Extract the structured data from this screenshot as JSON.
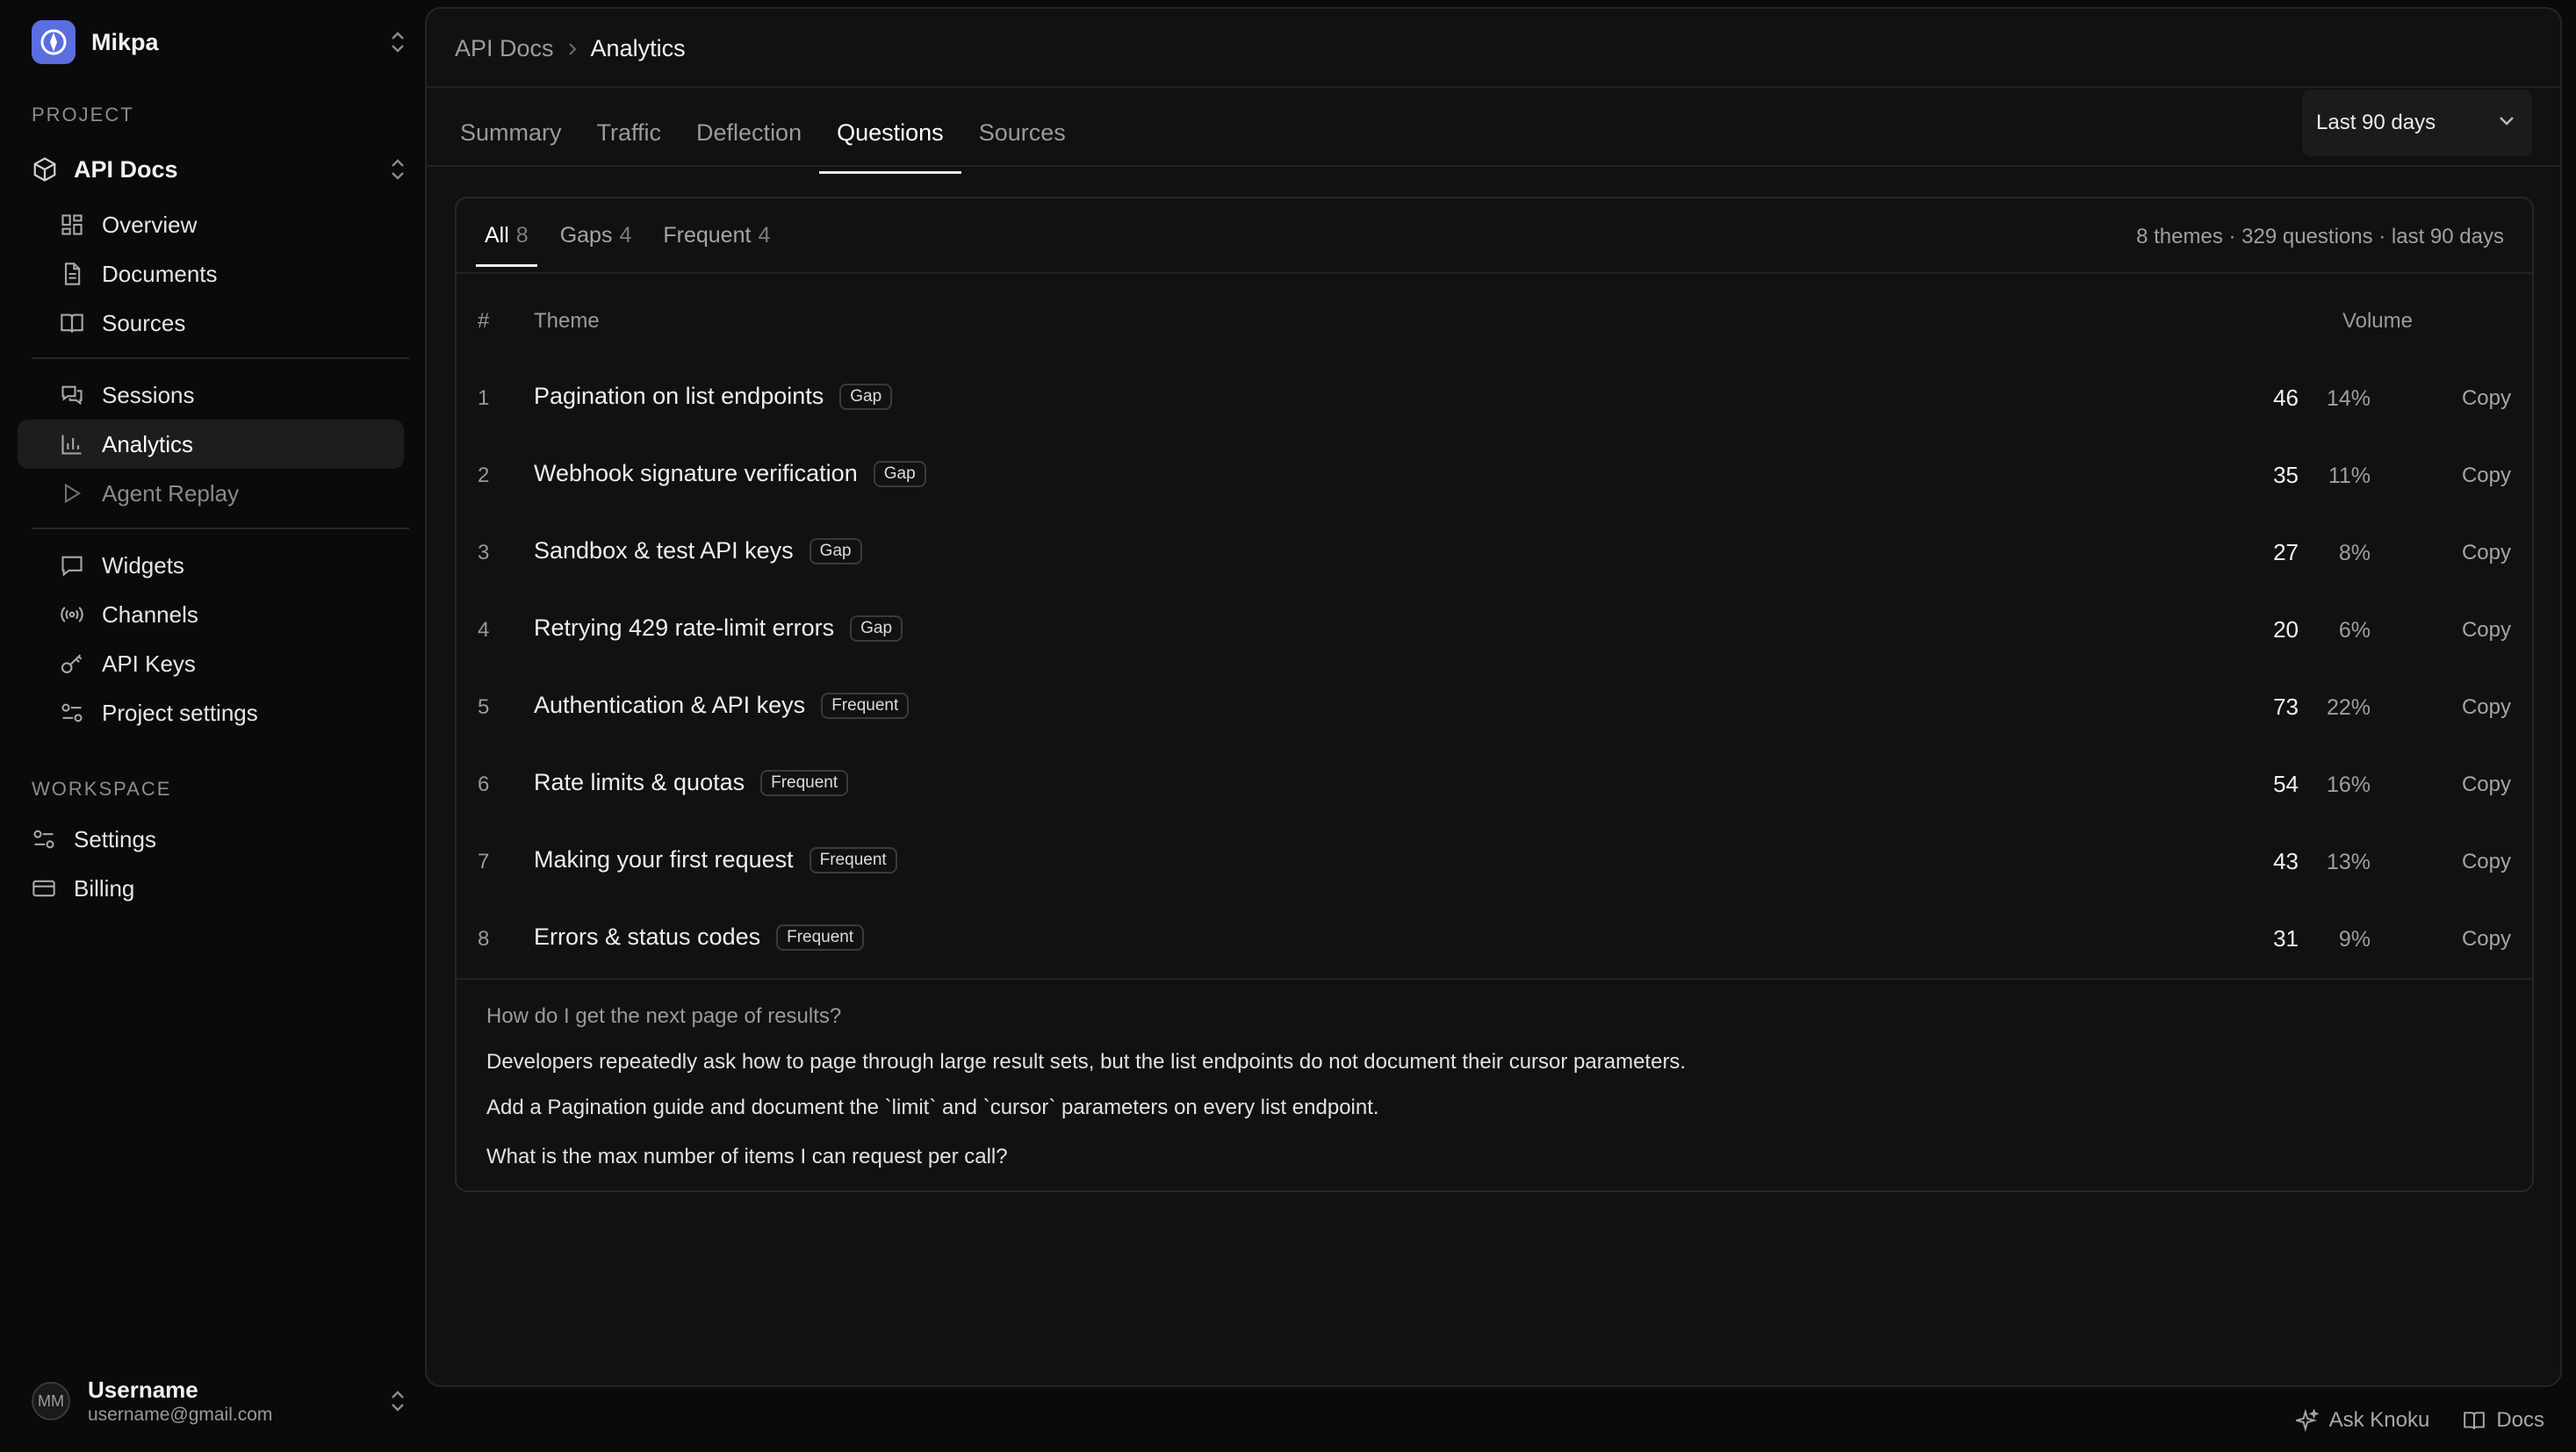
{
  "workspace": {
    "name": "Mikpa"
  },
  "sidebar": {
    "project_label": "PROJECT",
    "project_name": "API Docs",
    "project_items": [
      {
        "label": "Overview",
        "icon": "grid-icon"
      },
      {
        "label": "Documents",
        "icon": "document-icon"
      },
      {
        "label": "Sources",
        "icon": "book-icon"
      }
    ],
    "activity_items": [
      {
        "label": "Sessions",
        "icon": "chat-icon"
      },
      {
        "label": "Analytics",
        "icon": "bar-chart-icon",
        "active": true
      },
      {
        "label": "Agent Replay",
        "icon": "play-icon",
        "muted": true
      }
    ],
    "config_items": [
      {
        "label": "Widgets",
        "icon": "message-square-icon"
      },
      {
        "label": "Channels",
        "icon": "broadcast-icon"
      },
      {
        "label": "API Keys",
        "icon": "key-icon"
      },
      {
        "label": "Project settings",
        "icon": "sliders-icon"
      }
    ],
    "workspace_label": "WORKSPACE",
    "workspace_items": [
      {
        "label": "Settings",
        "icon": "sliders-icon"
      },
      {
        "label": "Billing",
        "icon": "credit-card-icon"
      }
    ]
  },
  "user": {
    "initials": "MM",
    "name": "Username",
    "email": "username@gmail.com"
  },
  "breadcrumb": {
    "parent": "API Docs",
    "current": "Analytics"
  },
  "tabs": [
    "Summary",
    "Traffic",
    "Deflection",
    "Questions",
    "Sources"
  ],
  "active_tab": "Questions",
  "date_range": {
    "selected": "Last 90 days"
  },
  "filters": [
    {
      "label": "All",
      "count": "8",
      "active": true
    },
    {
      "label": "Gaps",
      "count": "4"
    },
    {
      "label": "Frequent",
      "count": "4"
    }
  ],
  "summary": "8 themes · 329 questions · last 90 days",
  "table": {
    "headers": {
      "num": "#",
      "theme": "Theme",
      "volume": "Volume"
    },
    "copy_label": "Copy",
    "rows": [
      {
        "num": "1",
        "theme": "Pagination on list endpoints",
        "badge": "Gap",
        "count": "46",
        "pct": "14%"
      },
      {
        "num": "2",
        "theme": "Webhook signature verification",
        "badge": "Gap",
        "count": "35",
        "pct": "11%"
      },
      {
        "num": "3",
        "theme": "Sandbox & test API keys",
        "badge": "Gap",
        "count": "27",
        "pct": "8%"
      },
      {
        "num": "4",
        "theme": "Retrying 429 rate-limit errors",
        "badge": "Gap",
        "count": "20",
        "pct": "6%"
      },
      {
        "num": "5",
        "theme": "Authentication & API keys",
        "badge": "Frequent",
        "count": "73",
        "pct": "22%"
      },
      {
        "num": "6",
        "theme": "Rate limits & quotas",
        "badge": "Frequent",
        "count": "54",
        "pct": "16%"
      },
      {
        "num": "7",
        "theme": "Making your first request",
        "badge": "Frequent",
        "count": "43",
        "pct": "13%"
      },
      {
        "num": "8",
        "theme": "Errors & status codes",
        "badge": "Frequent",
        "count": "31",
        "pct": "9%"
      }
    ]
  },
  "detail": {
    "question": "How do I get the next page of results?",
    "insight": "Developers repeatedly ask how to page through large result sets, but the list endpoints do not document their cursor parameters.",
    "recommendation": "Add a Pagination guide and document the `limit` and `cursor` parameters on every list endpoint.",
    "related_question": "What is the max number of items I can request per call?"
  },
  "footer": {
    "ask_label": "Ask Knoku",
    "docs_label": "Docs"
  },
  "colors": {
    "accent": "#5b6ee0",
    "background": "#0a0a0a",
    "panel": "#111111"
  }
}
